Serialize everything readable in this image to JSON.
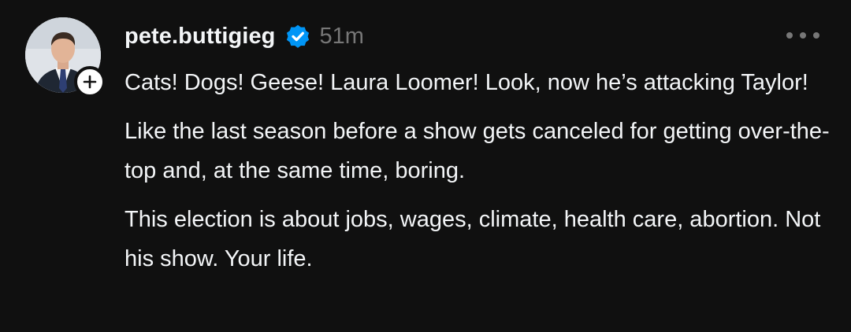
{
  "post": {
    "author": {
      "username": "pete.buttigieg",
      "verified_icon": "verified-badge-icon",
      "avatar_icon": "profile-photo",
      "follow_icon": "plus-icon"
    },
    "timestamp": "51m",
    "more_icon": "more-horizontal-icon",
    "paragraphs": [
      "Cats! Dogs! Geese! Laura Loomer! Look, now he’s attacking Taylor!",
      "Like the last season before a show gets canceled for getting over-the-top and, at the same time, boring.",
      "This election is about jobs, wages, climate, health care, abortion. Not his show. Your life."
    ]
  },
  "colors": {
    "background": "#101010",
    "text_primary": "#f3f5f7",
    "text_secondary": "#777777",
    "verified_blue": "#0095f6"
  }
}
